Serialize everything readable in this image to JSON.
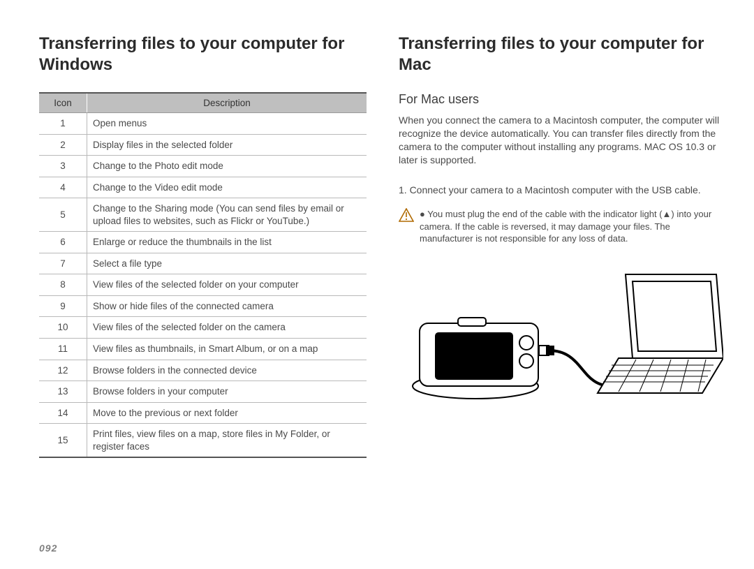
{
  "left": {
    "heading": "Transferring files to your computer for Windows",
    "table": {
      "header_icon": "Icon",
      "header_desc": "Description",
      "rows": [
        {
          "icon": "1",
          "desc": "Open menus"
        },
        {
          "icon": "2",
          "desc": "Display files in the selected folder"
        },
        {
          "icon": "3",
          "desc": "Change to the Photo edit mode"
        },
        {
          "icon": "4",
          "desc": "Change to the Video edit mode"
        },
        {
          "icon": "5",
          "desc": "Change to the Sharing mode (You can send files by email or upload files to websites, such as Flickr or YouTube.)"
        },
        {
          "icon": "6",
          "desc": "Enlarge or reduce the thumbnails in the list"
        },
        {
          "icon": "7",
          "desc": "Select a file type"
        },
        {
          "icon": "8",
          "desc": "View files of the selected folder on your computer"
        },
        {
          "icon": "9",
          "desc": "Show or hide files of the connected camera"
        },
        {
          "icon": "10",
          "desc": "View files of the selected folder on the camera"
        },
        {
          "icon": "11",
          "desc": "View files as thumbnails, in Smart Album, or on a map"
        },
        {
          "icon": "12",
          "desc": "Browse folders in the connected device"
        },
        {
          "icon": "13",
          "desc": "Browse folders in your computer"
        },
        {
          "icon": "14",
          "desc": "Move to the previous or next folder"
        },
        {
          "icon": "15",
          "desc": "Print files, view files on a map, store files in My Folder, or register faces"
        }
      ]
    }
  },
  "right": {
    "heading": "Transferring files to your computer for Mac",
    "subheading": "For Mac users",
    "paragraph": "When you connect the camera to a Macintosh computer, the computer will recognize the device automatically. You can transfer files directly from the camera to the computer without installing any programs. MAC OS 10.3 or later is supported.",
    "step1": "1. Connect your camera to a Macintosh computer with the USB cable.",
    "note": "You must plug the end of the cable with the indicator light (▲) into your camera. If the cable is reversed, it may damage your files. The manufacturer is not responsible for any loss of data."
  },
  "page_number": "092"
}
